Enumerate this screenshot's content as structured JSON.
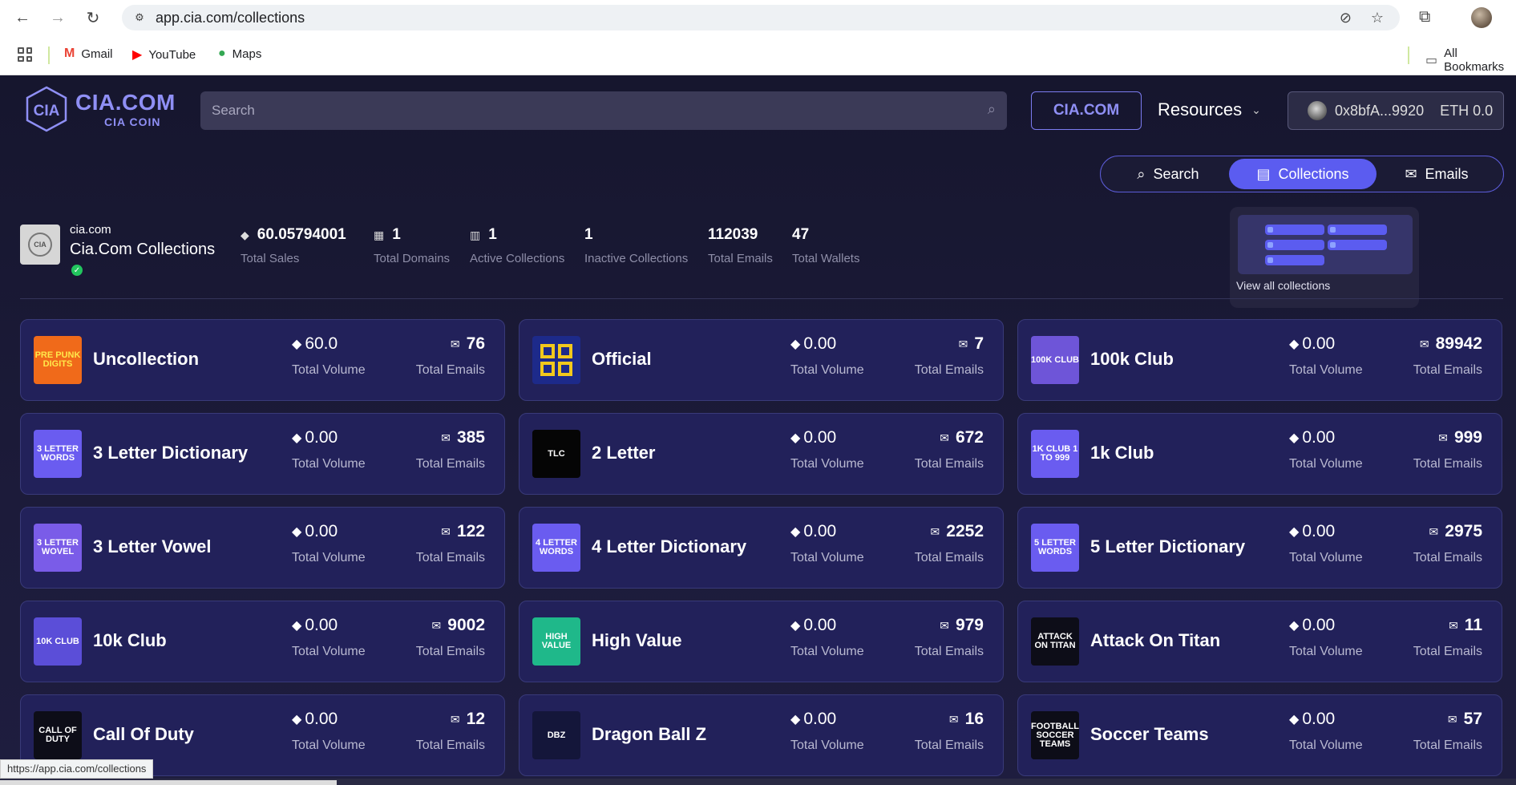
{
  "browser": {
    "url": "app.cia.com/collections",
    "status_url": "https://app.cia.com/collections",
    "bookmarks": [
      {
        "label": "Gmail",
        "icon": "gmail-icon",
        "glyph": "M",
        "color": "#ea4335"
      },
      {
        "label": "YouTube",
        "icon": "youtube-icon",
        "glyph": "▶",
        "color": "#ff0000"
      },
      {
        "label": "Maps",
        "icon": "maps-icon",
        "glyph": "⬤",
        "color": "#34a853"
      }
    ],
    "all_bookmarks": "All Bookmarks"
  },
  "header": {
    "logo_title": "CIA.COM",
    "logo_sub": "CIA COIN",
    "search_placeholder": "Search",
    "cia_button": "CIA.COM",
    "resources": "Resources",
    "wallet_address": "0x8bfA...9920",
    "wallet_balance": "ETH 0.0"
  },
  "tabs": [
    {
      "label": "Search",
      "icon": "search-icon"
    },
    {
      "label": "Collections",
      "icon": "collections-icon",
      "active": true
    },
    {
      "label": "Emails",
      "icon": "emails-icon"
    }
  ],
  "dropdown": {
    "label": "View all collections"
  },
  "summary": {
    "domain": "cia.com",
    "title": "Cia.Com Collections",
    "stats": [
      {
        "value": "60.05794001",
        "label": "Total Sales",
        "icon": "eth-icon"
      },
      {
        "value": "1",
        "label": "Total Domains",
        "icon": "domains-icon"
      },
      {
        "value": "1",
        "label": "Active Collections",
        "icon": "building-icon"
      },
      {
        "value": "1",
        "label": "Inactive Collections",
        "icon": ""
      },
      {
        "value": "112039",
        "label": "Total Emails",
        "icon": ""
      },
      {
        "value": "47",
        "label": "Total Wallets",
        "icon": ""
      }
    ]
  },
  "labels": {
    "volume": "Total Volume",
    "emails": "Total Emails"
  },
  "collections": [
    {
      "name": "Uncollection",
      "volume": "60.0",
      "emails": "76",
      "thumb": "PRE PUNK DIGITS",
      "bg": "#f06a1a",
      "fg": "#ffe84a"
    },
    {
      "name": "Official",
      "volume": "0.00",
      "emails": "7",
      "thumb": "",
      "bg": "#1d2a8a",
      "fg": "#f2c81c"
    },
    {
      "name": "100k Club",
      "volume": "0.00",
      "emails": "89942",
      "thumb": "100K CLUB",
      "bg": "#6e55d8",
      "fg": "#ffffff"
    },
    {
      "name": "3 Letter Dictionary",
      "volume": "0.00",
      "emails": "385",
      "thumb": "3 LETTER WORDS",
      "bg": "#6a5cf0",
      "fg": "#ffffff"
    },
    {
      "name": "2 Letter",
      "volume": "0.00",
      "emails": "672",
      "thumb": "TLC",
      "bg": "#050505",
      "fg": "#ffffff"
    },
    {
      "name": "1k Club",
      "volume": "0.00",
      "emails": "999",
      "thumb": "1K CLUB 1 TO 999",
      "bg": "#6a5cf0",
      "fg": "#ffffff"
    },
    {
      "name": "3 Letter Vowel",
      "volume": "0.00",
      "emails": "122",
      "thumb": "3 LETTER WOVEL",
      "bg": "#7a5ce8",
      "fg": "#ffffff"
    },
    {
      "name": "4 Letter Dictionary",
      "volume": "0.00",
      "emails": "2252",
      "thumb": "4 LETTER WORDS",
      "bg": "#6a5cf0",
      "fg": "#ffffff"
    },
    {
      "name": "5 Letter Dictionary",
      "volume": "0.00",
      "emails": "2975",
      "thumb": "5 LETTER WORDS",
      "bg": "#6a5cf0",
      "fg": "#ffffff"
    },
    {
      "name": "10k Club",
      "volume": "0.00",
      "emails": "9002",
      "thumb": "10K CLUB",
      "bg": "#5b4ed8",
      "fg": "#ffffff"
    },
    {
      "name": "High Value",
      "volume": "0.00",
      "emails": "979",
      "thumb": "HIGH VALUE",
      "bg": "#1fb88a",
      "fg": "#ffffff"
    },
    {
      "name": "Attack On Titan",
      "volume": "0.00",
      "emails": "11",
      "thumb": "ATTACK ON TITAN",
      "bg": "#0d0d18",
      "fg": "#ffffff"
    },
    {
      "name": "Call Of Duty",
      "volume": "0.00",
      "emails": "12",
      "thumb": "CALL OF DUTY",
      "bg": "#0d0d18",
      "fg": "#ffffff"
    },
    {
      "name": "Dragon Ball Z",
      "volume": "0.00",
      "emails": "16",
      "thumb": "DBZ",
      "bg": "#14163a",
      "fg": "#ffffff"
    },
    {
      "name": "Soccer Teams",
      "volume": "0.00",
      "emails": "57",
      "thumb": "FOOTBALL SOCCER TEAMS",
      "bg": "#0d0d18",
      "fg": "#ffffff"
    }
  ]
}
